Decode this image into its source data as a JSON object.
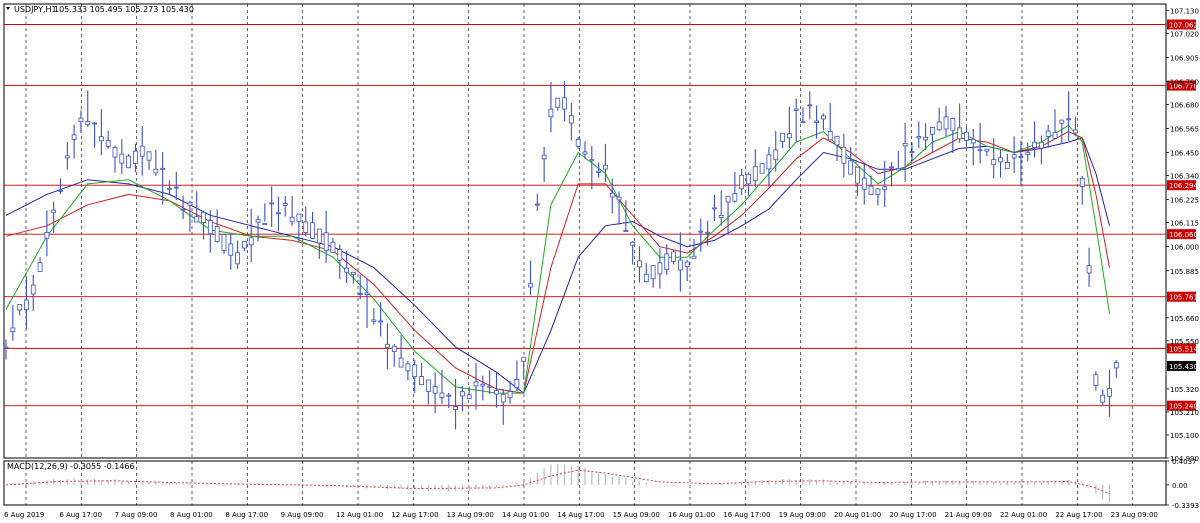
{
  "chart_data": {
    "type": "candlestick",
    "header": {
      "symbol_tf": "USDJPY,H1",
      "ohlc": "105.333 105.495 105.273 105.430"
    },
    "price_axis": {
      "min": 104.99,
      "max": 107.16,
      "ticks": [
        "107.130",
        "107.020",
        "106.905",
        "106.790",
        "106.680",
        "106.565",
        "106.450",
        "106.340",
        "106.225",
        "106.115",
        "106.000",
        "105.885",
        "105.660",
        "105.550",
        "105.320",
        "105.210",
        "105.100",
        "104.990"
      ]
    },
    "levels": [
      {
        "value": "107.062",
        "color": "#cc0000"
      },
      {
        "value": "106.770",
        "color": "#cc0000"
      },
      {
        "value": "106.294",
        "color": "#cc0000"
      },
      {
        "value": "106.060",
        "color": "#cc0000"
      },
      {
        "value": "105.761",
        "color": "#cc0000"
      },
      {
        "value": "105.514",
        "color": "#cc0000"
      },
      {
        "value": "105.240",
        "color": "#cc0000"
      }
    ],
    "current_price": {
      "value": "105.430",
      "color": "#000000"
    },
    "time_labels": [
      "6 Aug 2019",
      "6 Aug 17:00",
      "7 Aug 09:00",
      "8 Aug 01:00",
      "8 Aug 17:00",
      "9 Aug 09:00",
      "12 Aug 01:00",
      "12 Aug 17:00",
      "13 Aug 09:00",
      "14 Aug 01:00",
      "14 Aug 17:00",
      "15 Aug 09:00",
      "16 Aug 01:00",
      "16 Aug 17:00",
      "19 Aug 09:00",
      "20 Aug 01:00",
      "20 Aug 17:00",
      "21 Aug 09:00",
      "22 Aug 01:00",
      "22 Aug 17:00",
      "23 Aug 09:00"
    ],
    "price_path": [
      [
        0,
        105.52
      ],
      [
        2,
        105.7
      ],
      [
        4,
        105.78
      ],
      [
        6,
        106.05
      ],
      [
        8,
        106.28
      ],
      [
        10,
        106.55
      ],
      [
        12,
        106.62
      ],
      [
        14,
        106.53
      ],
      [
        16,
        106.45
      ],
      [
        18,
        106.4
      ],
      [
        20,
        106.46
      ],
      [
        22,
        106.38
      ],
      [
        24,
        106.3
      ],
      [
        26,
        106.2
      ],
      [
        28,
        106.15
      ],
      [
        30,
        106.1
      ],
      [
        32,
        106.02
      ],
      [
        34,
        105.95
      ],
      [
        36,
        106.05
      ],
      [
        38,
        106.15
      ],
      [
        40,
        106.2
      ],
      [
        42,
        106.15
      ],
      [
        44,
        106.1
      ],
      [
        46,
        106.05
      ],
      [
        48,
        106.0
      ],
      [
        50,
        105.9
      ],
      [
        52,
        105.8
      ],
      [
        54,
        105.68
      ],
      [
        56,
        105.55
      ],
      [
        58,
        105.45
      ],
      [
        60,
        105.4
      ],
      [
        62,
        105.33
      ],
      [
        64,
        105.3
      ],
      [
        66,
        105.25
      ],
      [
        68,
        105.3
      ],
      [
        70,
        105.35
      ],
      [
        72,
        105.3
      ],
      [
        74,
        105.28
      ],
      [
        76,
        105.45
      ],
      [
        78,
        106.2
      ],
      [
        80,
        106.65
      ],
      [
        82,
        106.7
      ],
      [
        84,
        106.5
      ],
      [
        86,
        106.4
      ],
      [
        88,
        106.35
      ],
      [
        90,
        106.2
      ],
      [
        92,
        106.0
      ],
      [
        94,
        105.85
      ],
      [
        96,
        105.9
      ],
      [
        98,
        105.95
      ],
      [
        100,
        105.9
      ],
      [
        102,
        106.05
      ],
      [
        104,
        106.15
      ],
      [
        106,
        106.2
      ],
      [
        108,
        106.3
      ],
      [
        110,
        106.35
      ],
      [
        112,
        106.4
      ],
      [
        114,
        106.5
      ],
      [
        116,
        106.62
      ],
      [
        118,
        106.65
      ],
      [
        120,
        106.6
      ],
      [
        122,
        106.5
      ],
      [
        124,
        106.38
      ],
      [
        126,
        106.3
      ],
      [
        128,
        106.25
      ],
      [
        130,
        106.35
      ],
      [
        132,
        106.45
      ],
      [
        134,
        106.5
      ],
      [
        136,
        106.55
      ],
      [
        138,
        106.6
      ],
      [
        140,
        106.55
      ],
      [
        142,
        106.5
      ],
      [
        144,
        106.45
      ],
      [
        146,
        106.4
      ],
      [
        148,
        106.42
      ],
      [
        150,
        106.45
      ],
      [
        152,
        106.5
      ],
      [
        154,
        106.55
      ],
      [
        156,
        106.62
      ],
      [
        157,
        106.55
      ],
      [
        158,
        106.3
      ],
      [
        159,
        105.9
      ],
      [
        160,
        105.35
      ],
      [
        161,
        105.28
      ],
      [
        162,
        105.3
      ],
      [
        163,
        105.43
      ]
    ],
    "ma_fast": [
      [
        0,
        105.7
      ],
      [
        6,
        106.05
      ],
      [
        12,
        106.3
      ],
      [
        18,
        106.32
      ],
      [
        24,
        106.22
      ],
      [
        30,
        106.08
      ],
      [
        36,
        106.05
      ],
      [
        42,
        106.05
      ],
      [
        48,
        105.95
      ],
      [
        54,
        105.75
      ],
      [
        60,
        105.5
      ],
      [
        66,
        105.33
      ],
      [
        72,
        105.3
      ],
      [
        76,
        105.3
      ],
      [
        80,
        106.2
      ],
      [
        84,
        106.45
      ],
      [
        88,
        106.35
      ],
      [
        92,
        106.1
      ],
      [
        96,
        105.95
      ],
      [
        100,
        105.95
      ],
      [
        104,
        106.08
      ],
      [
        108,
        106.2
      ],
      [
        112,
        106.35
      ],
      [
        116,
        106.5
      ],
      [
        120,
        106.55
      ],
      [
        124,
        106.42
      ],
      [
        128,
        106.3
      ],
      [
        132,
        106.38
      ],
      [
        136,
        106.5
      ],
      [
        140,
        106.55
      ],
      [
        144,
        106.48
      ],
      [
        148,
        106.45
      ],
      [
        152,
        106.5
      ],
      [
        156,
        106.58
      ],
      [
        158,
        106.5
      ],
      [
        160,
        106.1
      ],
      [
        162,
        105.68
      ]
    ],
    "ma_mid": [
      [
        0,
        106.05
      ],
      [
        6,
        106.1
      ],
      [
        12,
        106.2
      ],
      [
        18,
        106.25
      ],
      [
        24,
        106.22
      ],
      [
        30,
        106.12
      ],
      [
        36,
        106.05
      ],
      [
        42,
        106.03
      ],
      [
        48,
        105.98
      ],
      [
        54,
        105.82
      ],
      [
        60,
        105.6
      ],
      [
        66,
        105.42
      ],
      [
        72,
        105.32
      ],
      [
        76,
        105.3
      ],
      [
        80,
        105.9
      ],
      [
        84,
        106.3
      ],
      [
        88,
        106.3
      ],
      [
        92,
        106.15
      ],
      [
        96,
        106.0
      ],
      [
        100,
        105.97
      ],
      [
        104,
        106.05
      ],
      [
        108,
        106.15
      ],
      [
        112,
        106.28
      ],
      [
        116,
        106.42
      ],
      [
        120,
        106.52
      ],
      [
        124,
        106.45
      ],
      [
        128,
        106.35
      ],
      [
        132,
        106.38
      ],
      [
        136,
        106.45
      ],
      [
        140,
        106.52
      ],
      [
        144,
        106.5
      ],
      [
        148,
        106.45
      ],
      [
        152,
        106.48
      ],
      [
        156,
        106.55
      ],
      [
        158,
        106.52
      ],
      [
        160,
        106.25
      ],
      [
        162,
        105.9
      ]
    ],
    "ma_slow": [
      [
        0,
        106.15
      ],
      [
        6,
        106.25
      ],
      [
        12,
        106.32
      ],
      [
        18,
        106.3
      ],
      [
        24,
        106.25
      ],
      [
        30,
        106.15
      ],
      [
        36,
        106.1
      ],
      [
        42,
        106.05
      ],
      [
        48,
        106.0
      ],
      [
        54,
        105.9
      ],
      [
        60,
        105.72
      ],
      [
        66,
        105.52
      ],
      [
        72,
        105.4
      ],
      [
        76,
        105.3
      ],
      [
        80,
        105.6
      ],
      [
        84,
        105.95
      ],
      [
        88,
        106.1
      ],
      [
        92,
        106.12
      ],
      [
        96,
        106.05
      ],
      [
        100,
        106.0
      ],
      [
        104,
        106.03
      ],
      [
        108,
        106.1
      ],
      [
        112,
        106.18
      ],
      [
        116,
        106.32
      ],
      [
        120,
        106.45
      ],
      [
        124,
        106.42
      ],
      [
        128,
        106.37
      ],
      [
        132,
        106.37
      ],
      [
        136,
        106.42
      ],
      [
        140,
        106.47
      ],
      [
        144,
        106.48
      ],
      [
        148,
        106.45
      ],
      [
        152,
        106.47
      ],
      [
        156,
        106.5
      ],
      [
        158,
        106.52
      ],
      [
        160,
        106.35
      ],
      [
        162,
        106.1
      ]
    ],
    "indicator": {
      "label": "MACD(12,26,9) -0.3055 -0.1466",
      "ticks": [
        "0.4037",
        "0.00",
        "-0.3393"
      ],
      "min": -0.3393,
      "max": 0.4037,
      "histogram": [
        [
          0,
          0.0
        ],
        [
          4,
          0.05
        ],
        [
          8,
          0.1
        ],
        [
          12,
          0.1
        ],
        [
          16,
          0.08
        ],
        [
          20,
          0.05
        ],
        [
          24,
          0.03
        ],
        [
          30,
          0.0
        ],
        [
          36,
          0.01
        ],
        [
          42,
          0.01
        ],
        [
          48,
          -0.02
        ],
        [
          54,
          -0.05
        ],
        [
          60,
          -0.08
        ],
        [
          66,
          -0.1
        ],
        [
          72,
          -0.05
        ],
        [
          76,
          0.05
        ],
        [
          80,
          0.35
        ],
        [
          84,
          0.32
        ],
        [
          88,
          0.18
        ],
        [
          92,
          0.08
        ],
        [
          96,
          -0.02
        ],
        [
          100,
          0.0
        ],
        [
          104,
          0.02
        ],
        [
          108,
          0.05
        ],
        [
          112,
          0.08
        ],
        [
          116,
          0.1
        ],
        [
          120,
          0.08
        ],
        [
          124,
          0.05
        ],
        [
          128,
          0.02
        ],
        [
          132,
          0.04
        ],
        [
          136,
          0.06
        ],
        [
          140,
          0.08
        ],
        [
          144,
          0.05
        ],
        [
          148,
          0.04
        ],
        [
          152,
          0.05
        ],
        [
          156,
          0.07
        ],
        [
          158,
          0.05
        ],
        [
          160,
          -0.15
        ],
        [
          162,
          -0.3
        ]
      ],
      "signal": [
        [
          0,
          0.0
        ],
        [
          8,
          0.06
        ],
        [
          16,
          0.07
        ],
        [
          24,
          0.04
        ],
        [
          36,
          0.01
        ],
        [
          48,
          -0.01
        ],
        [
          60,
          -0.06
        ],
        [
          72,
          -0.05
        ],
        [
          76,
          0.0
        ],
        [
          80,
          0.15
        ],
        [
          84,
          0.25
        ],
        [
          88,
          0.2
        ],
        [
          96,
          0.05
        ],
        [
          104,
          0.02
        ],
        [
          112,
          0.06
        ],
        [
          120,
          0.07
        ],
        [
          128,
          0.04
        ],
        [
          136,
          0.05
        ],
        [
          144,
          0.05
        ],
        [
          152,
          0.05
        ],
        [
          156,
          0.06
        ],
        [
          160,
          -0.05
        ],
        [
          162,
          -0.15
        ]
      ]
    },
    "colors": {
      "candles": "#3a50c8",
      "ma_fast": "#22aa22",
      "ma_mid": "#cc2222",
      "ma_slow": "#2020aa",
      "grid": "#000000",
      "indicator": "#bbbbbb",
      "signal": "#cc3333"
    }
  }
}
